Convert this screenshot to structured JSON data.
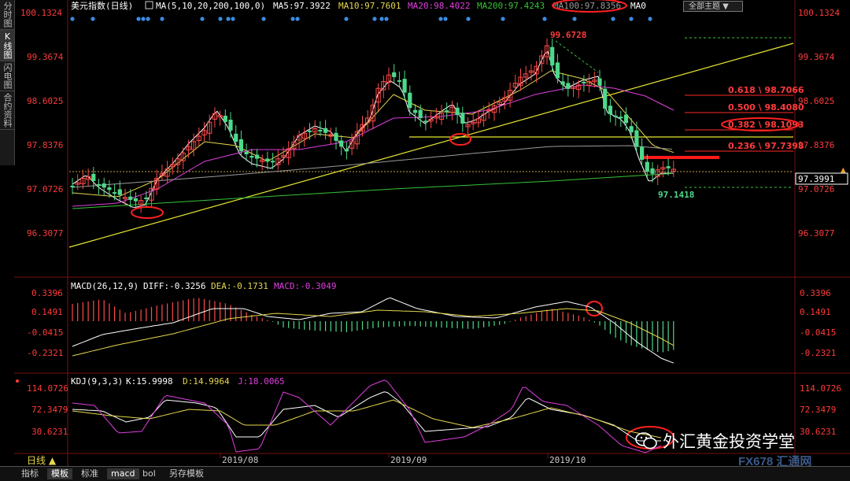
{
  "header": {
    "symbol": "美元指数(日线)",
    "ma_params": "MA(5,10,20,200,100,0)",
    "ma5": "MA5:97.3922",
    "ma10": "MA10:97.7601",
    "ma20": "MA20:98.4022",
    "ma200": "MA200:97.4243",
    "ma100": "MA100:97.8356",
    "ma0": "MA0",
    "theme_select": "全部主题 ▼"
  },
  "side_tabs": [
    "分时图",
    "K线图",
    "闪电图",
    "合约资料"
  ],
  "price_axis": {
    "left": [
      "100.1324",
      "99.3674",
      "98.6025",
      "97.8376",
      "97.0726",
      "96.3077"
    ],
    "right": [
      "100.1324",
      "99.3674",
      "98.6025",
      "97.8376",
      "97.0726",
      "96.3077"
    ],
    "current_price": "97.3991"
  },
  "annotations": {
    "high": "99.6728",
    "low": "97.1418",
    "fib": [
      "0.618 \\ 98.7066",
      "0.500 \\ 98.4080",
      "0.382 \\ 98.1093",
      "0.236 \\ 97.7398"
    ]
  },
  "macd": {
    "header": "MACD(26,12,9)",
    "diff": "DIFF:-0.3256",
    "dea": "DEA:-0.1731",
    "macd": "MACD:-0.3049",
    "axis": [
      "0.3396",
      "0.1491",
      "-0.0415",
      "-0.2321"
    ]
  },
  "kdj": {
    "header": "KDJ(9,3,3)",
    "k": "K:15.9998",
    "d": "D:14.9964",
    "j": "J:18.0065",
    "axis": [
      "114.0726",
      "72.3479",
      "30.6231"
    ]
  },
  "x_axis": {
    "period_label": "日线 ▲",
    "months": [
      "2019/08",
      "2019/09",
      "2019/10"
    ]
  },
  "bottom_tabs": [
    "指标",
    "模板",
    "标准",
    "macd",
    "bol",
    "另存模板"
  ],
  "watermark": {
    "text": "外汇黄金投资学堂",
    "logo": "FX678 汇通网"
  },
  "colors": {
    "up": "#ff4a4a",
    "down": "#4ed98a",
    "ma5": "#ffffff",
    "ma10": "#e6d74d",
    "ma20": "#e03ee0",
    "ma200": "#36c336",
    "ma100": "#9a9a9a",
    "axis_text": "#ff3b3b",
    "fib_line": "#ff2a2a",
    "trend_line": "#e6e632"
  }
}
